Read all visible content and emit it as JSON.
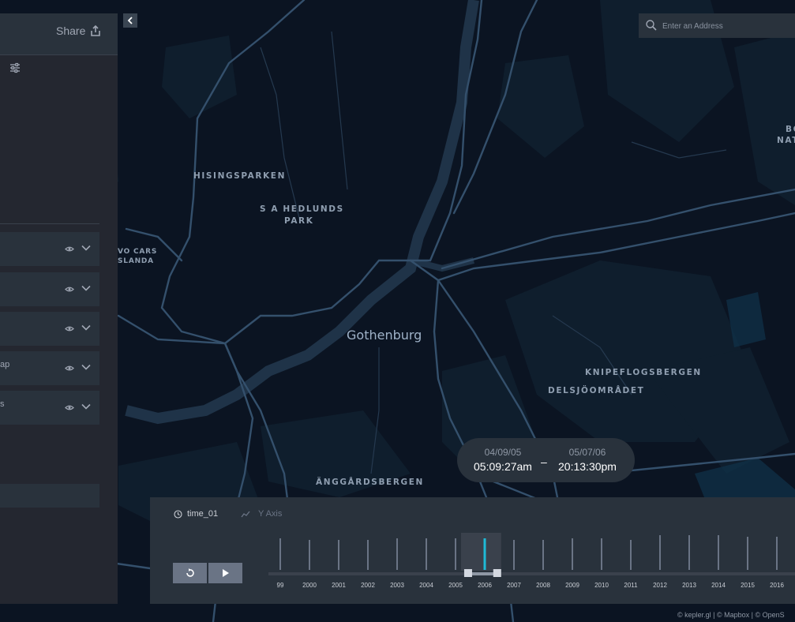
{
  "side_panel": {
    "share_label": "Share",
    "layers": [
      {
        "name": ""
      },
      {
        "name": ""
      },
      {
        "name": ""
      },
      {
        "name": "ap"
      },
      {
        "name": "s"
      }
    ],
    "icons": {
      "share": "share-upload-icon",
      "filter": "sliders-icon",
      "visibility": "eye-icon",
      "expand": "chevron-down-icon"
    }
  },
  "map": {
    "city": "Gothenburg",
    "labels": {
      "hisingsparken": "HISINGSPARKEN",
      "sa_hedlunds_1": "S A HEDLUNDS",
      "sa_hedlunds_2": "PARK",
      "volvo_1": "VO CARS",
      "volvo_2": "SLANDA",
      "knipeflogsbergen": "KNIPEFLOGSBERGEN",
      "delsjoomradet": "DELSJÖOMRÅDET",
      "anggardsbergen": "ÄNGGÅRDSBERGEN",
      "edge_1": "BO",
      "edge_2": "NAT"
    }
  },
  "geocoder": {
    "placeholder": "Enter an Address",
    "icon": "search-icon"
  },
  "time_readout": {
    "start_date": "04/09/05",
    "start_time": "05:09:27am",
    "end_date": "05/07/06",
    "end_time": "20:13:30pm",
    "separator": "–"
  },
  "time_panel": {
    "field_name": "time_01",
    "yaxis_label": "Y Axis",
    "icons": {
      "field": "clock-icon",
      "yaxis": "line-chart-icon",
      "reset": "reset-icon",
      "play": "play-icon"
    }
  },
  "chart_data": {
    "type": "bar",
    "categories": [
      "99",
      "2000",
      "2001",
      "2002",
      "2003",
      "2004",
      "2005",
      "2006",
      "2007",
      "2008",
      "2009",
      "2010",
      "2011",
      "2012",
      "2013",
      "2014",
      "2015",
      "2016"
    ],
    "values": [
      40,
      38,
      38,
      38,
      40,
      40,
      40,
      40,
      38,
      38,
      40,
      40,
      38,
      44,
      44,
      44,
      42,
      42
    ],
    "selected_range": [
      "2005",
      "2006"
    ],
    "colors": {
      "bar": "#6a7485",
      "selected": "#1fbad6",
      "range_bg": "#3a414c"
    }
  },
  "attribution": "© kepler.gl | © Mapbox | © OpenS"
}
